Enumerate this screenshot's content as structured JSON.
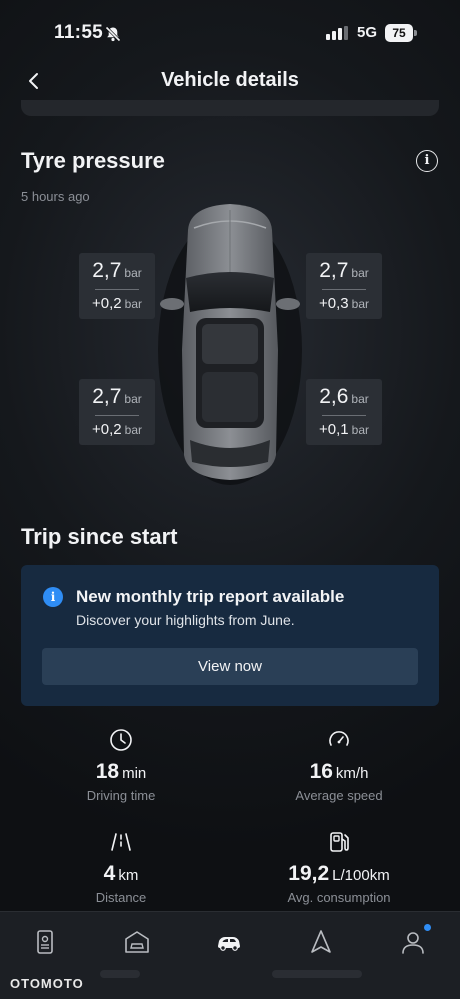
{
  "status_bar": {
    "time": "11:55",
    "network": "5G",
    "battery": "75"
  },
  "header": {
    "title": "Vehicle details"
  },
  "tyre_pressure": {
    "title": "Tyre pressure",
    "updated": "5 hours ago",
    "unit": "bar",
    "tyres": {
      "front_left": {
        "pressure": "2,7",
        "delta": "+0,2"
      },
      "front_right": {
        "pressure": "2,7",
        "delta": "+0,3"
      },
      "rear_left": {
        "pressure": "2,7",
        "delta": "+0,2"
      },
      "rear_right": {
        "pressure": "2,6",
        "delta": "+0,1"
      }
    }
  },
  "trip": {
    "title": "Trip since start",
    "report": {
      "title": "New monthly trip report available",
      "subtitle": "Discover your highlights from June.",
      "button": "View now"
    },
    "stats": {
      "driving_time": {
        "value": "18",
        "unit": "min",
        "label": "Driving time"
      },
      "average_speed": {
        "value": "16",
        "unit": "km/h",
        "label": "Average speed"
      },
      "distance": {
        "value": "4",
        "unit": "km",
        "label": "Distance"
      },
      "consumption": {
        "value": "19,2",
        "unit": "L/100km",
        "label": "Avg. consumption"
      }
    }
  },
  "bottom_nav": {
    "items": [
      {
        "icon": "document-icon"
      },
      {
        "icon": "garage-icon"
      },
      {
        "icon": "car-icon",
        "active": true
      },
      {
        "icon": "navigation-icon"
      },
      {
        "icon": "profile-icon",
        "badge": true
      }
    ]
  },
  "watermark": "OTOMOTO",
  "colors": {
    "accent": "#2f8df5",
    "card": "#172a40",
    "background": "#0e1013"
  }
}
